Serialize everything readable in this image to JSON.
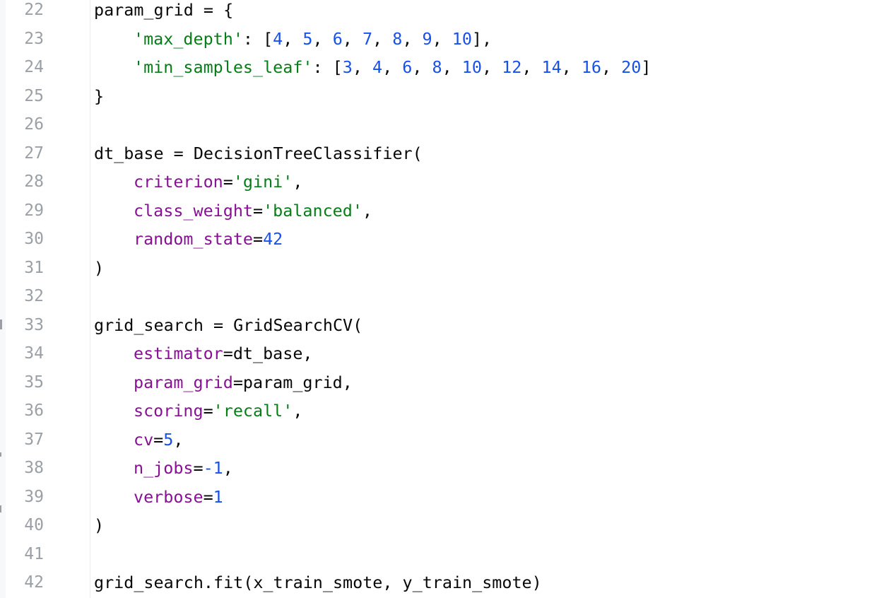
{
  "editor": {
    "colors": {
      "string": "#067d17",
      "number": "#1750eb",
      "keyword_arg": "#871094",
      "plain": "#080808",
      "line_number": "#9aa0a6"
    },
    "lines": [
      {
        "num": "22",
        "indent": 0,
        "tokens": [
          {
            "t": "param_grid = {",
            "c": "plain"
          }
        ]
      },
      {
        "num": "23",
        "indent": 1,
        "tokens": [
          {
            "t": "'max_depth'",
            "c": "str"
          },
          {
            "t": ": [",
            "c": "plain"
          },
          {
            "t": "4",
            "c": "num"
          },
          {
            "t": ", ",
            "c": "plain"
          },
          {
            "t": "5",
            "c": "num"
          },
          {
            "t": ", ",
            "c": "plain"
          },
          {
            "t": "6",
            "c": "num"
          },
          {
            "t": ", ",
            "c": "plain"
          },
          {
            "t": "7",
            "c": "num"
          },
          {
            "t": ", ",
            "c": "plain"
          },
          {
            "t": "8",
            "c": "num"
          },
          {
            "t": ", ",
            "c": "plain"
          },
          {
            "t": "9",
            "c": "num"
          },
          {
            "t": ", ",
            "c": "plain"
          },
          {
            "t": "10",
            "c": "num"
          },
          {
            "t": "],",
            "c": "plain"
          }
        ]
      },
      {
        "num": "24",
        "indent": 1,
        "tokens": [
          {
            "t": "'min_samples_leaf'",
            "c": "str"
          },
          {
            "t": ": [",
            "c": "plain"
          },
          {
            "t": "3",
            "c": "num"
          },
          {
            "t": ", ",
            "c": "plain"
          },
          {
            "t": "4",
            "c": "num"
          },
          {
            "t": ", ",
            "c": "plain"
          },
          {
            "t": "6",
            "c": "num"
          },
          {
            "t": ", ",
            "c": "plain"
          },
          {
            "t": "8",
            "c": "num"
          },
          {
            "t": ", ",
            "c": "plain"
          },
          {
            "t": "10",
            "c": "num"
          },
          {
            "t": ", ",
            "c": "plain"
          },
          {
            "t": "12",
            "c": "num"
          },
          {
            "t": ", ",
            "c": "plain"
          },
          {
            "t": "14",
            "c": "num"
          },
          {
            "t": ", ",
            "c": "plain"
          },
          {
            "t": "16",
            "c": "num"
          },
          {
            "t": ", ",
            "c": "plain"
          },
          {
            "t": "20",
            "c": "num"
          },
          {
            "t": "]",
            "c": "plain"
          }
        ]
      },
      {
        "num": "25",
        "indent": 0,
        "tokens": [
          {
            "t": "}",
            "c": "plain"
          }
        ]
      },
      {
        "num": "26",
        "indent": 0,
        "tokens": []
      },
      {
        "num": "27",
        "indent": 0,
        "tokens": [
          {
            "t": "dt_base = DecisionTreeClassifier(",
            "c": "plain"
          }
        ]
      },
      {
        "num": "28",
        "indent": 1,
        "tokens": [
          {
            "t": "criterion",
            "c": "kw"
          },
          {
            "t": "=",
            "c": "plain"
          },
          {
            "t": "'gini'",
            "c": "str"
          },
          {
            "t": ",",
            "c": "plain"
          }
        ]
      },
      {
        "num": "29",
        "indent": 1,
        "tokens": [
          {
            "t": "class_weight",
            "c": "kw"
          },
          {
            "t": "=",
            "c": "plain"
          },
          {
            "t": "'balanced'",
            "c": "str"
          },
          {
            "t": ",",
            "c": "plain"
          }
        ]
      },
      {
        "num": "30",
        "indent": 1,
        "tokens": [
          {
            "t": "random_state",
            "c": "kw"
          },
          {
            "t": "=",
            "c": "plain"
          },
          {
            "t": "42",
            "c": "num"
          }
        ]
      },
      {
        "num": "31",
        "indent": 0,
        "tokens": [
          {
            "t": ")",
            "c": "plain"
          }
        ]
      },
      {
        "num": "32",
        "indent": 0,
        "tokens": []
      },
      {
        "num": "33",
        "indent": 0,
        "tokens": [
          {
            "t": "grid_search = GridSearchCV(",
            "c": "plain"
          }
        ]
      },
      {
        "num": "34",
        "indent": 1,
        "tokens": [
          {
            "t": "estimator",
            "c": "kw"
          },
          {
            "t": "=dt_base,",
            "c": "plain"
          }
        ]
      },
      {
        "num": "35",
        "indent": 1,
        "tokens": [
          {
            "t": "param_grid",
            "c": "kw"
          },
          {
            "t": "=param_grid,",
            "c": "plain"
          }
        ]
      },
      {
        "num": "36",
        "indent": 1,
        "tokens": [
          {
            "t": "scoring",
            "c": "kw"
          },
          {
            "t": "=",
            "c": "plain"
          },
          {
            "t": "'recall'",
            "c": "str"
          },
          {
            "t": ",",
            "c": "plain"
          }
        ]
      },
      {
        "num": "37",
        "indent": 1,
        "tokens": [
          {
            "t": "cv",
            "c": "kw"
          },
          {
            "t": "=",
            "c": "plain"
          },
          {
            "t": "5",
            "c": "num"
          },
          {
            "t": ",",
            "c": "plain"
          }
        ]
      },
      {
        "num": "38",
        "indent": 1,
        "tokens": [
          {
            "t": "n_jobs",
            "c": "kw"
          },
          {
            "t": "=",
            "c": "plain"
          },
          {
            "t": "-1",
            "c": "num"
          },
          {
            "t": ",",
            "c": "plain"
          }
        ]
      },
      {
        "num": "39",
        "indent": 1,
        "tokens": [
          {
            "t": "verbose",
            "c": "kw"
          },
          {
            "t": "=",
            "c": "plain"
          },
          {
            "t": "1",
            "c": "num"
          }
        ]
      },
      {
        "num": "40",
        "indent": 0,
        "tokens": [
          {
            "t": ")",
            "c": "plain"
          }
        ]
      },
      {
        "num": "41",
        "indent": 0,
        "tokens": []
      },
      {
        "num": "42",
        "indent": 0,
        "tokens": [
          {
            "t": "grid_search.fit(x_train_smote, y_train_smote)",
            "c": "plain"
          }
        ]
      }
    ]
  }
}
